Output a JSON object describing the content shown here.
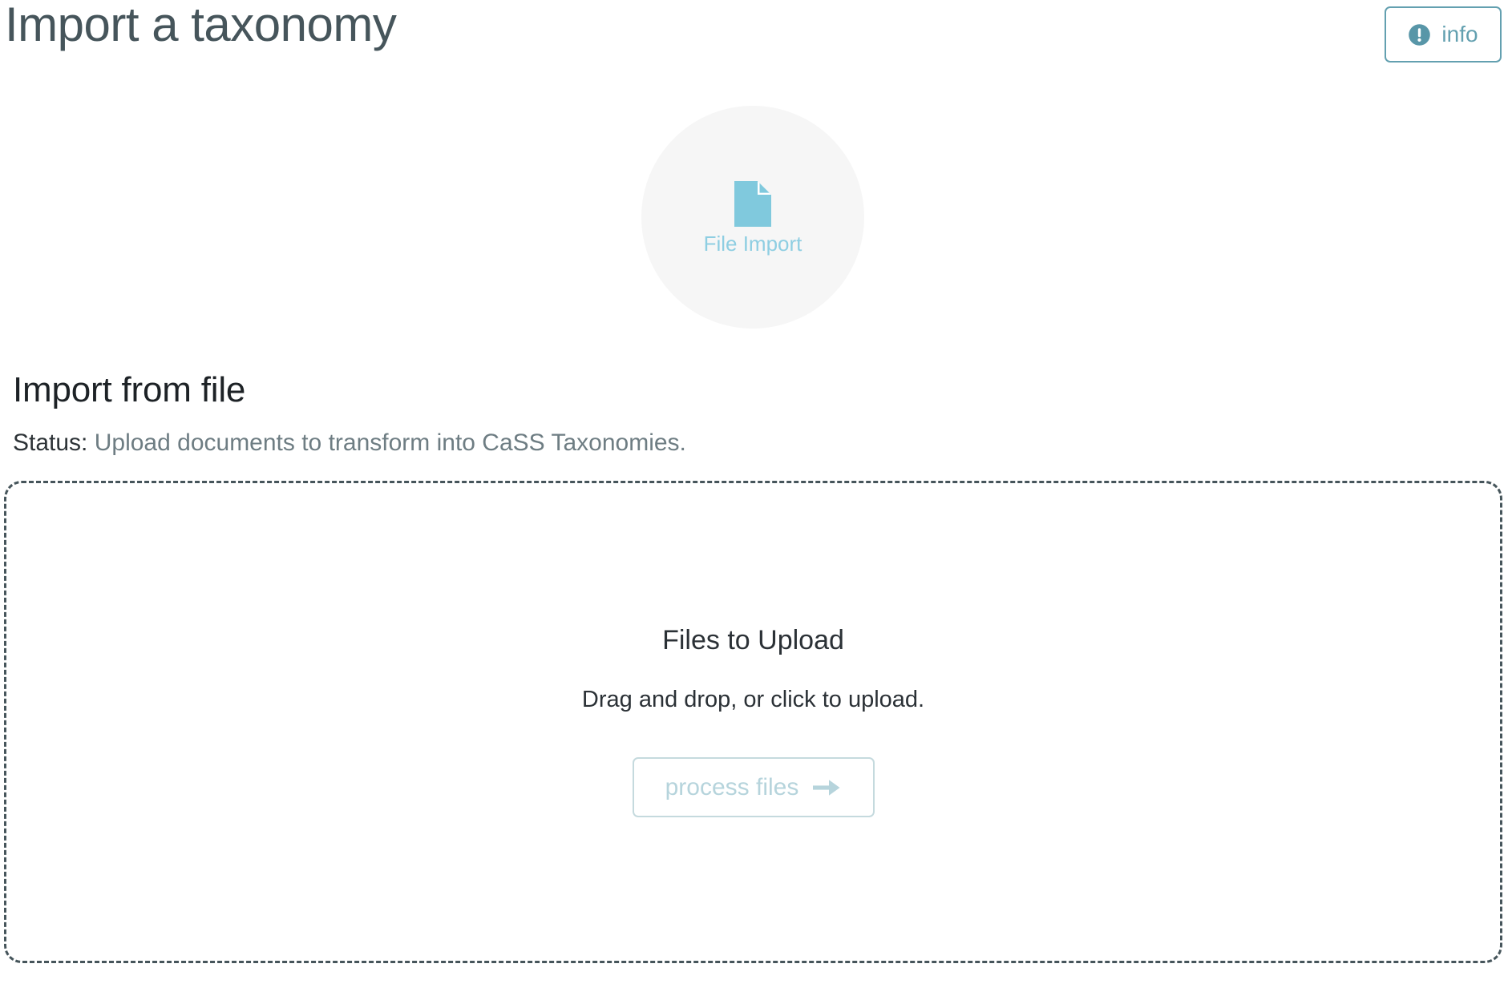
{
  "header": {
    "title": "Import a taxonomy",
    "info_button": {
      "label": "info",
      "icon": "exclamation-circle-icon",
      "color": "#63a0b0"
    }
  },
  "emblem": {
    "label": "File Import",
    "icon": "file-document-icon",
    "icon_color": "#80c9dd",
    "circle_color": "#f6f6f6"
  },
  "section": {
    "heading": "Import from file",
    "status_key": "Status:",
    "status_value": "Upload documents to transform into CaSS Taxonomies."
  },
  "dropzone": {
    "title": "Files to Upload",
    "subtitle": "Drag and drop, or click to upload.",
    "border_color": "#46555b",
    "process_button": {
      "label": "process files",
      "icon": "arrow-right-icon",
      "color": "#b6d4dc"
    }
  }
}
